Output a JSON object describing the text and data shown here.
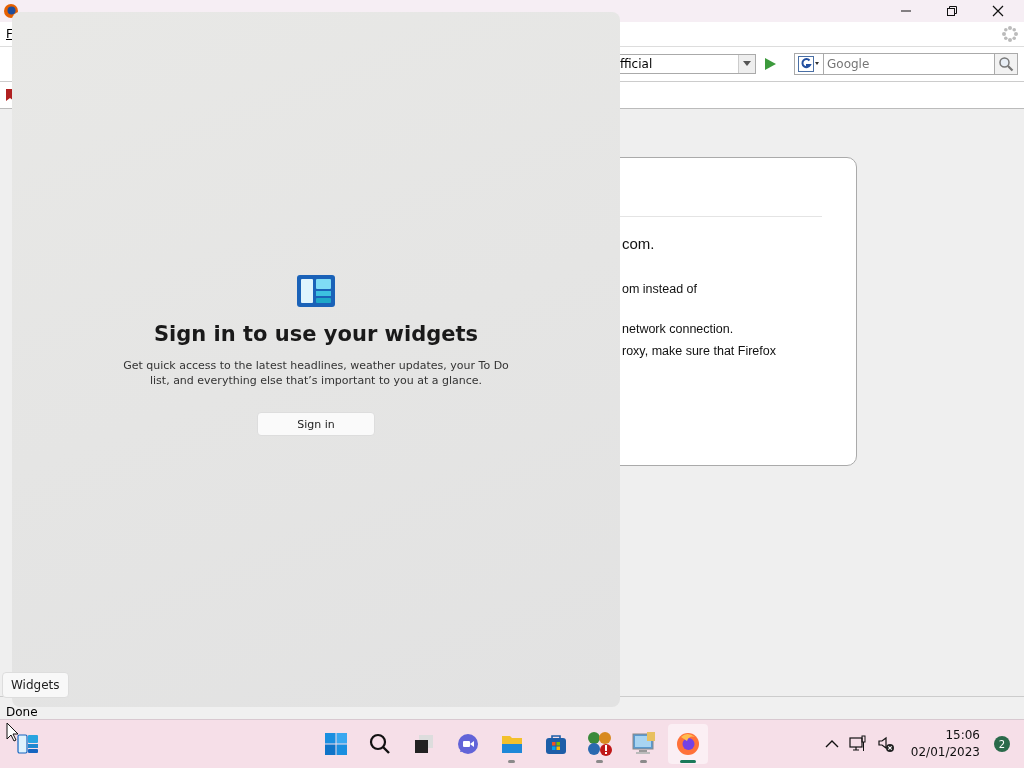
{
  "menu": {
    "items": [
      "F"
    ]
  },
  "navigation": {
    "address": "fficial",
    "search_placeholder": "Google"
  },
  "page": {
    "lines": [
      {
        "kind": "heading",
        "text": "com."
      },
      {
        "kind": "body",
        "text": "om instead of"
      },
      {
        "kind": "body",
        "text": "network connection."
      },
      {
        "kind": "body",
        "text": "roxy, make sure that Firefox"
      }
    ]
  },
  "status_bar": "Done",
  "widgets_panel": {
    "heading": "Sign in to use your widgets",
    "description": "Get quick access to the latest headlines, weather updates, your To Do list, and everything else that’s important to you at a glance.",
    "button": "Sign in"
  },
  "tooltip": "Widgets",
  "taskbar": {
    "apps": [
      {
        "kind": "start",
        "running": false,
        "selected": false
      },
      {
        "kind": "search",
        "running": false,
        "selected": false
      },
      {
        "kind": "taskview",
        "running": false,
        "selected": false
      },
      {
        "kind": "chat",
        "running": false,
        "selected": false
      },
      {
        "kind": "explorer",
        "running": true,
        "selected": false
      },
      {
        "kind": "store",
        "running": false,
        "selected": false
      },
      {
        "kind": "games",
        "running": true,
        "selected": false
      },
      {
        "kind": "computer",
        "running": true,
        "selected": false
      },
      {
        "kind": "firefox",
        "running": true,
        "selected": true
      }
    ],
    "time": "15:06",
    "date": "02/01/2023",
    "notifications": "2"
  }
}
